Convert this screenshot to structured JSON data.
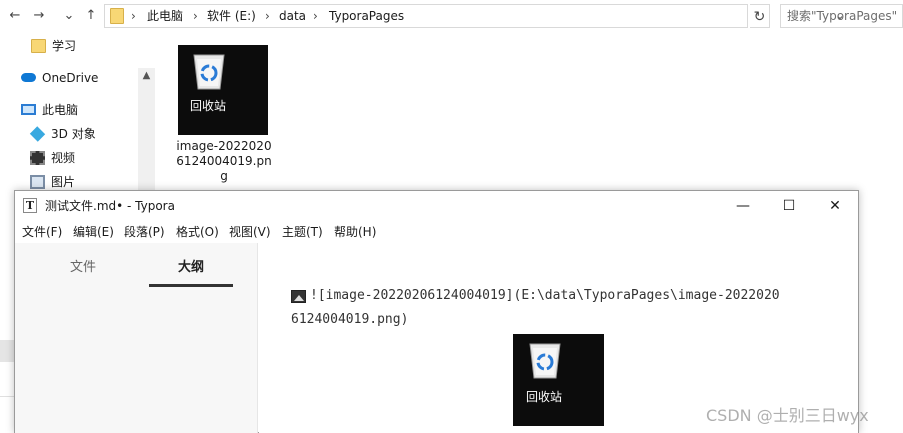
{
  "explorer": {
    "nav": {
      "back": "←",
      "forward": "→",
      "recent": "⌄",
      "up": "↑"
    },
    "breadcrumbs": [
      "此电脑",
      "软件 (E:)",
      "data",
      "TyporaPages"
    ],
    "address_dropdown": "⌄",
    "refresh": "↻",
    "search_placeholder": "搜索\"TyporaPages\"",
    "scroll_up": "▲",
    "nav_items": [
      {
        "label": "学习",
        "icon": "folder-icon"
      },
      {
        "label": "OneDrive",
        "icon": "onedrive-cloud-icon"
      },
      {
        "label": "此电脑",
        "icon": "this-pc-icon"
      },
      {
        "label": "3D 对象",
        "icon": "3d-objects-icon"
      },
      {
        "label": "视频",
        "icon": "video-icon"
      },
      {
        "label": "图片",
        "icon": "pictures-icon"
      }
    ],
    "file": {
      "name": "image-20220206124004019.png",
      "thumb_label": "回收站"
    }
  },
  "typora": {
    "app_icon": "T",
    "title": "测试文件.md• - Typora",
    "controls": {
      "minimize": "—",
      "maximize": "☐",
      "close": "✕"
    },
    "menu": [
      "文件(F)",
      "编辑(E)",
      "段落(P)",
      "格式(O)",
      "视图(V)",
      "主题(T)",
      "帮助(H)"
    ],
    "sidebar_tabs": {
      "files": "文件",
      "outline": "大纲"
    },
    "markdown_line1": "![image-20220206124004019](E:\\data\\TyporaPages\\image-2022020",
    "markdown_line2": "6124004019.png)",
    "preview_label": "回收站"
  },
  "watermark": "CSDN @士别三日wyx",
  "colors": {
    "folder": "#f8d775",
    "onedrive": "#0f78d4",
    "thumb_bg": "#0c0c0c",
    "recycle_blue": "#2a7bd6"
  }
}
